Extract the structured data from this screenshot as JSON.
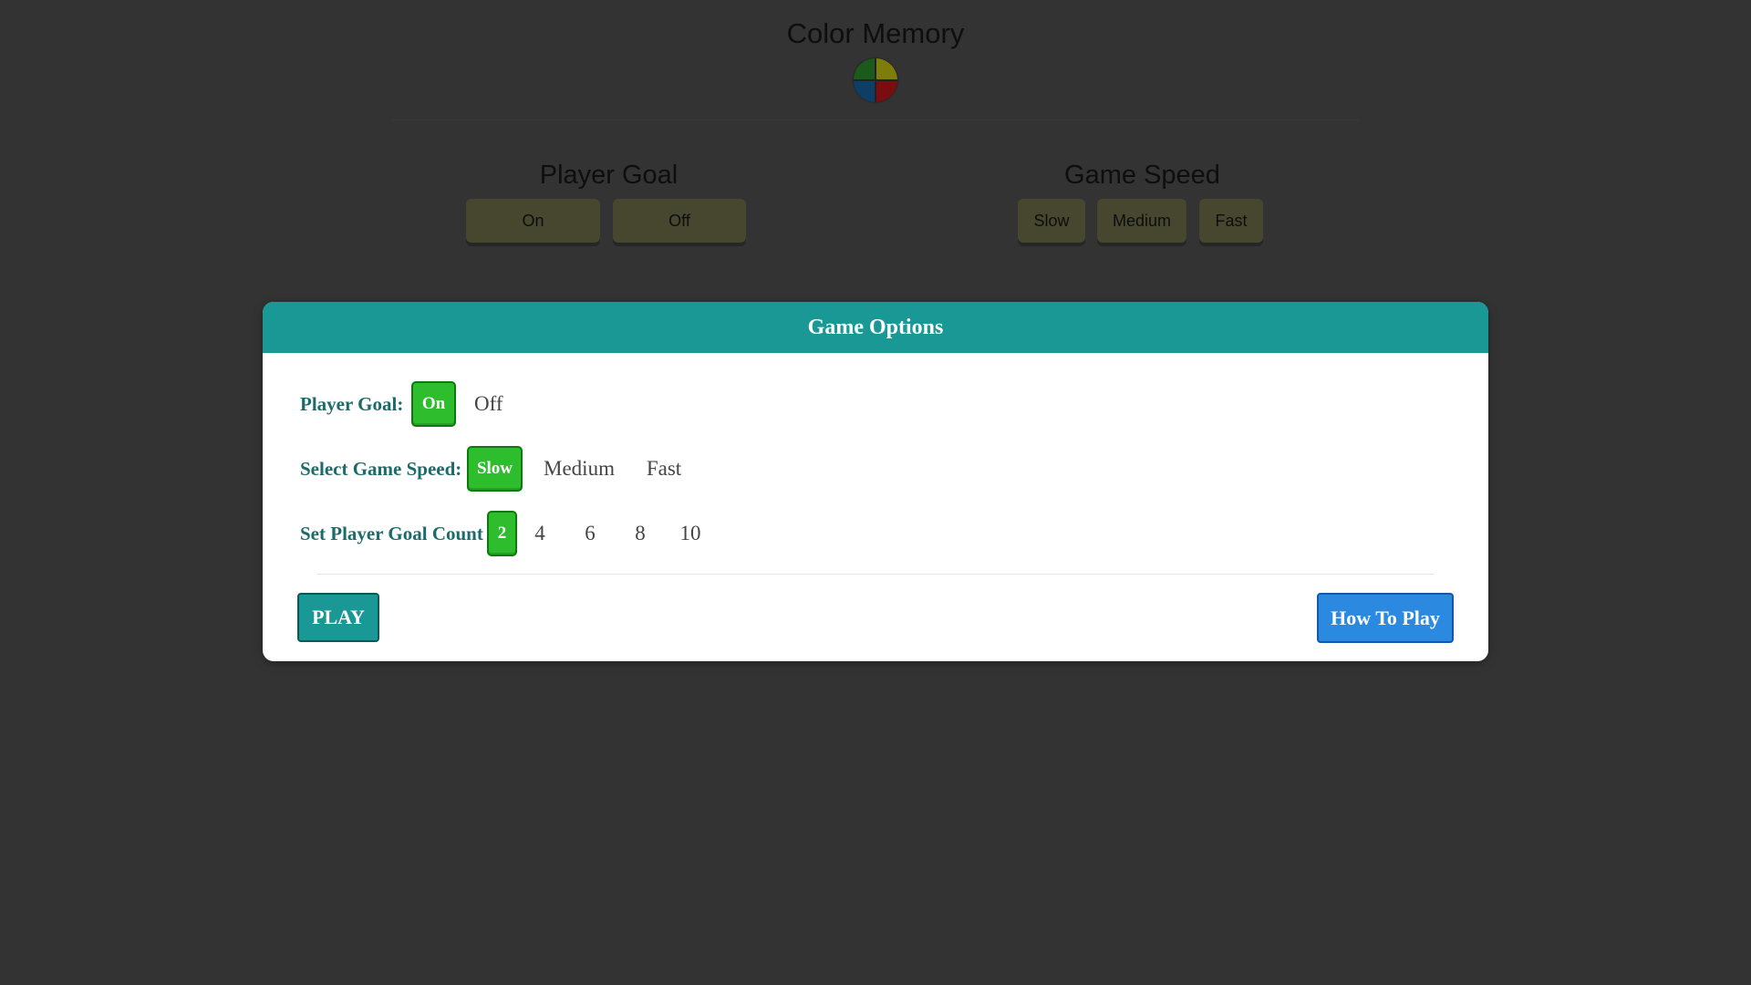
{
  "background": {
    "title": "Color Memory",
    "logo_icon": "four-color-quadrant-icon",
    "player_goal": {
      "title": "Player Goal",
      "options": [
        "On",
        "Off"
      ]
    },
    "game_speed": {
      "title": "Game Speed",
      "options": [
        "Slow",
        "Medium",
        "Fast"
      ]
    }
  },
  "modal": {
    "title": "Game Options",
    "player_goal": {
      "label": "Player Goal:",
      "options": [
        "On",
        "Off"
      ],
      "selected": "On"
    },
    "game_speed": {
      "label": "Select Game Speed:",
      "options": [
        "Slow",
        "Medium",
        "Fast"
      ],
      "selected": "Slow"
    },
    "goal_count": {
      "label": "Set Player Goal Count",
      "options": [
        "2",
        "4",
        "6",
        "8",
        "10"
      ],
      "selected": "2"
    },
    "play_label": "PLAY",
    "how_to_label": "How To Play"
  },
  "colors": {
    "page_bg": "#333333",
    "modal_header": "#1a9895",
    "selected_option": "#2dbd2d",
    "how_to_button": "#2b8ae0",
    "label_text": "#1a6b69"
  }
}
